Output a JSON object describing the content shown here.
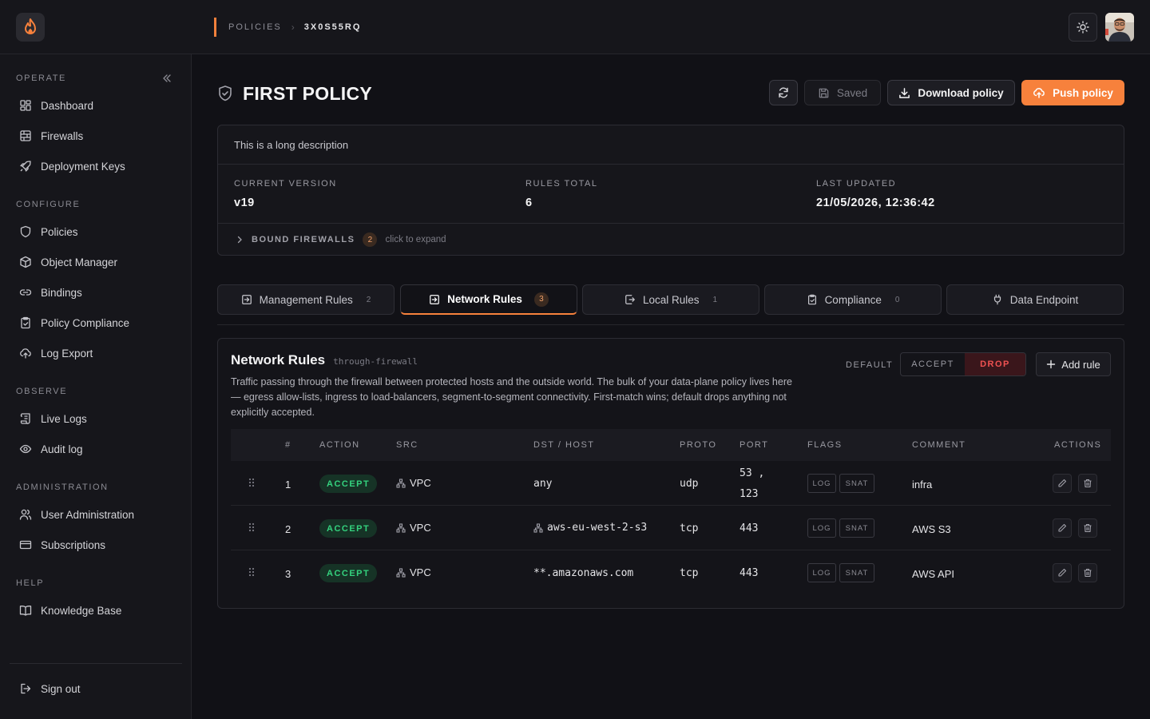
{
  "breadcrumb": {
    "section": "POLICIES",
    "current": "3X0S55RQ"
  },
  "sidebar": {
    "sections": [
      {
        "label": "OPERATE",
        "items": [
          {
            "label": "Dashboard",
            "icon": "dashboard-icon"
          },
          {
            "label": "Firewalls",
            "icon": "firewall-icon"
          },
          {
            "label": "Deployment Keys",
            "icon": "rocket-icon"
          }
        ]
      },
      {
        "label": "CONFIGURE",
        "items": [
          {
            "label": "Policies",
            "icon": "shield-icon"
          },
          {
            "label": "Object Manager",
            "icon": "cube-icon"
          },
          {
            "label": "Bindings",
            "icon": "link-icon"
          },
          {
            "label": "Policy Compliance",
            "icon": "clipboard-check-icon"
          },
          {
            "label": "Log Export",
            "icon": "cloud-upload-icon"
          }
        ]
      },
      {
        "label": "OBSERVE",
        "items": [
          {
            "label": "Live Logs",
            "icon": "scroll-icon"
          },
          {
            "label": "Audit log",
            "icon": "eye-icon"
          }
        ]
      },
      {
        "label": "ADMINISTRATION",
        "items": [
          {
            "label": "User Administration",
            "icon": "users-icon"
          },
          {
            "label": "Subscriptions",
            "icon": "credit-card-icon"
          }
        ]
      },
      {
        "label": "HELP",
        "items": [
          {
            "label": "Knowledge Base",
            "icon": "book-icon"
          }
        ]
      }
    ],
    "signout": "Sign out"
  },
  "page": {
    "title": "FIRST POLICY",
    "buttons": {
      "saved": "Saved",
      "download": "Download policy",
      "push": "Push policy"
    },
    "description": "This is a long description",
    "stats": [
      {
        "label": "CURRENT VERSION",
        "value": "v19"
      },
      {
        "label": "RULES TOTAL",
        "value": "6"
      },
      {
        "label": "LAST UPDATED",
        "value": "21/05/2026, 12:36:42"
      }
    ],
    "bound": {
      "label": "BOUND FIREWALLS",
      "count": "2",
      "hint": "click to expand"
    }
  },
  "tabs": [
    {
      "label": "Management Rules",
      "count": "2",
      "icon": "login-icon"
    },
    {
      "label": "Network Rules",
      "count": "3",
      "icon": "arrow-in-box-icon",
      "active": true
    },
    {
      "label": "Local Rules",
      "count": "1",
      "icon": "arrow-out-box-icon"
    },
    {
      "label": "Compliance",
      "count": "0",
      "icon": "clipboard-icon"
    },
    {
      "label": "Data Endpoint",
      "count": "",
      "icon": "plug-icon"
    }
  ],
  "rules": {
    "title": "Network Rules",
    "tag": "through-firewall",
    "description": "Traffic passing through the firewall between protected hosts and the outside world. The bulk of your data-plane policy lives here — egress allow-lists, ingress to load-balancers, segment-to-segment connectivity. First-match wins; default drops anything not explicitly accepted.",
    "default_label": "DEFAULT",
    "default_accept": "ACCEPT",
    "default_drop": "DROP",
    "add_rule": "Add rule",
    "columns": [
      "#",
      "ACTION",
      "SRC",
      "DST / HOST",
      "PROTO",
      "PORT",
      "FLAGS",
      "COMMENT",
      "ACTIONS"
    ],
    "rows": [
      {
        "num": "1",
        "action": "ACCEPT",
        "src": "VPC",
        "dst": "any",
        "proto": "udp",
        "port1": "53 ,",
        "port2": "123",
        "flag1": "LOG",
        "flag2": "SNAT",
        "comment": "infra"
      },
      {
        "num": "2",
        "action": "ACCEPT",
        "src": "VPC",
        "dst": "aws-eu-west-2-s3",
        "proto": "tcp",
        "port1": "443",
        "port2": "",
        "flag1": "LOG",
        "flag2": "SNAT",
        "comment": "AWS S3"
      },
      {
        "num": "3",
        "action": "ACCEPT",
        "src": "VPC",
        "dst": "**.amazonaws.com",
        "proto": "tcp",
        "port1": "443",
        "port2": "",
        "flag1": "LOG",
        "flag2": "SNAT",
        "comment": "AWS API"
      }
    ]
  },
  "colors": {
    "accent": "#f7813c",
    "accept": "#34d27e",
    "drop": "#f05252",
    "background": "#111116"
  }
}
